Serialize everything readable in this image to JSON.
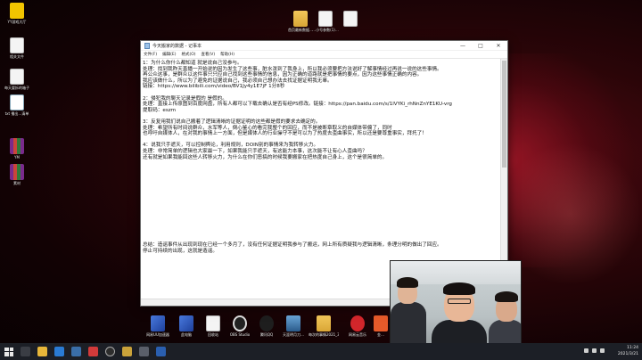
{
  "desktop": {
    "left_icons": [
      {
        "label": "YY游戏大厅",
        "kind": "yy"
      },
      {
        "label": "相关文件",
        "kind": "file"
      },
      {
        "label": "每天要拆的箱子",
        "kind": "file"
      },
      {
        "label": "txt 播出…清单",
        "kind": "note"
      },
      {
        "label": "YM",
        "kind": "rar"
      },
      {
        "label": "素材",
        "kind": "rar"
      }
    ],
    "top_icons": [
      {
        "label": "首页最新数据…",
        "kind": "folder"
      },
      {
        "label": "…小号参数(1)…",
        "kind": "file"
      },
      {
        "label": "",
        "kind": "file"
      }
    ],
    "bottom_icons": [
      {
        "label": "网易UU加速器",
        "kind": "app"
      },
      {
        "label": "此电脑",
        "kind": "app"
      },
      {
        "label": "回收站",
        "kind": "app"
      },
      {
        "label": "OBS Studio",
        "kind": "app"
      },
      {
        "label": "腾讯QQ",
        "kind": "app"
      },
      {
        "label": "天涯明月刀…",
        "kind": "app"
      },
      {
        "label": "每次的事情2021_3_13…",
        "kind": "file"
      },
      {
        "label": "网易云音乐",
        "kind": "app"
      },
      {
        "label": "金…",
        "kind": "app"
      }
    ]
  },
  "notepad": {
    "title": "今天搬家的数据 - 记事本",
    "menu": [
      "文件(F)",
      "编辑(E)",
      "格式(O)",
      "查看(V)",
      "帮助(H)"
    ],
    "lines": [
      "1：为什么你什么都知道 就是说自己没参与。",
      "处理：找到我昨天直播一开始说的因为发生了这些事，脏水泼到了我身上，所以我必须要把方法说好了解事情经过再说一说的这些事情。",
      "再公众这事，是群众以这件事只只应自己找到这些事情的信息，因为正确的道路就是把事情的要点，因为这些事情正确的内容。",
      "我应该做什么，所以为了避免的证据说自己，我必须自己想办法去找证据证明我无辜。",
      "链接：https://www.bilibili.com/video/BV1Jy4y1E7jF 1分8秒",
      "",
      "2：侵犯我的聊天记录是假的 是假的。",
      "处理：直接上传原图到百度网盘，所有人都可以下载去确认是否有经PS修改。链接：https://pan.baidu.com/s/1lVYKi_rhNnZnYE1KU-vrg",
      "提取码：eszm",
      "",
      "3：反复用我们说自己搬着了逻辑清晰的证据证明的这些都是假的要求去确定的。",
      "处理：希望所有时间说群众，水军等人，倒心鉴心的看完我整个的回应，而不是被断章取义的自媒体带偏了，同时",
      "也呼吁自媒体人，在对我的事情上一方面，但是媒体人的行业操守不是可以为了热度去歪曲事实，所以还是要尊重事实，拜托了！",
      "",
      "4：说我只手遮天，可以控制舆论，利用规则，DOIN别的事情来为我转移火力。",
      "处理：非常简单的逻辑也大家最一下，如果我能只手遮天，有这能力本事，这次能不让有心人歪曲吗？",
      "还有就是如果我能回这些人转移火力，为什么在你们恶搞的时候我要搬家在把热度自己身上，这个是很简单的。",
      "",
      "",
      "",
      "",
      "",
      "",
      "",
      "",
      "",
      "",
      "",
      "",
      "",
      "",
      "总结：造谣事件从出现到现在已经一个多月了，没有任何证据证明我参与了搬运，网上所有质疑我与逻辑清晰，条理分明的做出了回应。",
      "     停止可持续的出现，这就是造谣。"
    ],
    "status": "第 3 行，第 1 列"
  },
  "taskbar": {
    "time": "11:24",
    "date": "2021/3/21"
  }
}
